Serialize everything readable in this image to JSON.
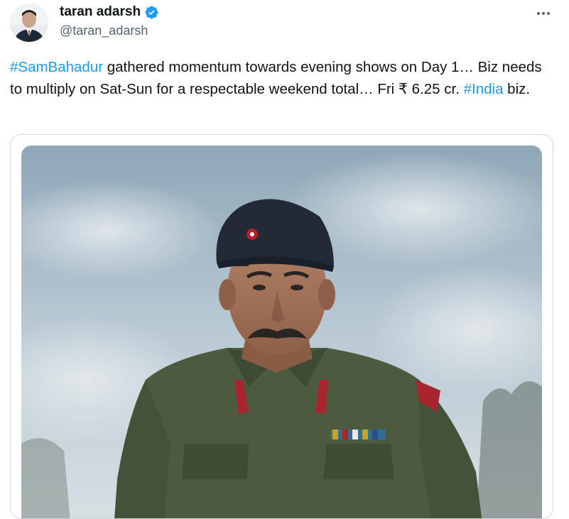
{
  "author": {
    "display_name": "taran adarsh",
    "handle": "@taran_adarsh",
    "verified_icon": "verified-badge-icon",
    "avatar_icon": "profile-photo"
  },
  "more_icon": "more-options-icon",
  "tweet": {
    "hashtag1": "#SamBahadur",
    "segment1": " gathered momentum towards evening shows on Day 1… Biz needs to multiply on Sat-Sun for a respectable weekend total… Fri ₹ 6.25 cr. ",
    "hashtag2": "#India",
    "segment2": " biz."
  },
  "media": {
    "kind": "photo",
    "subject": "poster image"
  },
  "colors": {
    "link": "#1d9bf0",
    "text": "#0f1419",
    "secondary": "#536471",
    "verified": "#1d9bf0",
    "border": "#cfd9de"
  }
}
